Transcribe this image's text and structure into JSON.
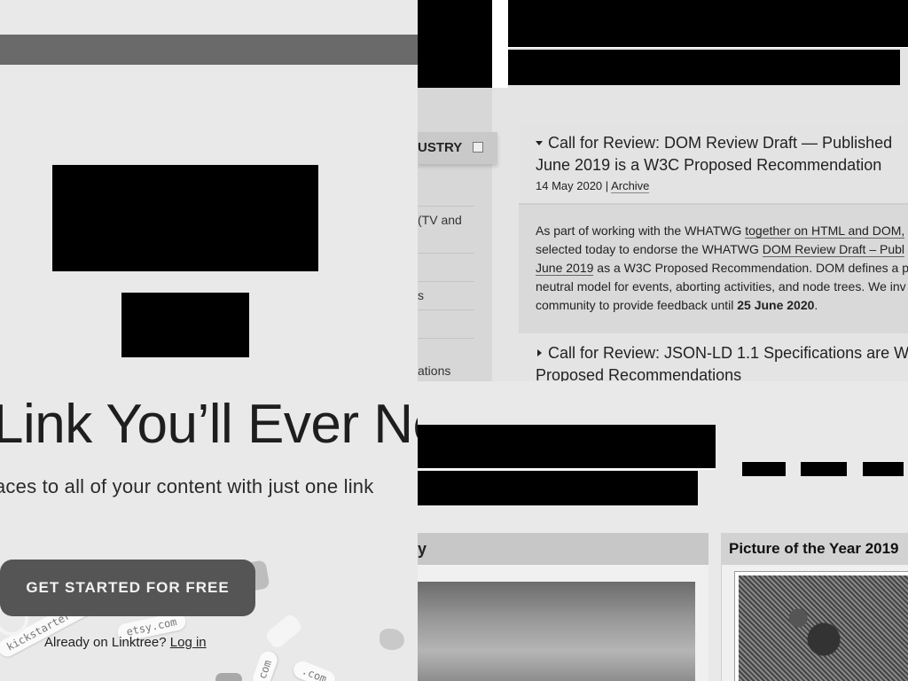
{
  "w3c": {
    "sidebar": {
      "industry_label": "USTRY",
      "items": [
        "(TV and",
        "s",
        "ations"
      ]
    },
    "news": [
      {
        "title_line1": "Call for Review: DOM Review Draft — Published",
        "title_line2": "June 2019 is a W3C Proposed Recommendation",
        "date": "14 May 2020",
        "separator": " | ",
        "archive_label": "Archive",
        "body": {
          "l1a": "As part of working with the WHATWG ",
          "l1b": "together on HTML and DOM,",
          "l2a": "selected today to endorse the WHATWG ",
          "l2b": "DOM Review Draft – Publ",
          "l3a": "June 2019",
          "l3b": " as a W3C Proposed Recommendation. DOM defines a p",
          "l4": "neutral model for events, aborting activities, and node trees. We inv",
          "l5a": "community to provide feedback until ",
          "l5b": "25 June 2020",
          "l5c": "."
        }
      },
      {
        "title_line1": "Call for Review: JSON-LD 1.1 Specifications are W",
        "title_line2": "Proposed Recommendations"
      }
    ]
  },
  "bottom": {
    "panel1_title": "y",
    "panel2_title": "Picture of the Year 2019"
  },
  "linktree": {
    "headline": "Link You’ll Ever Ne",
    "subheadline": "aces to all of your content with just one link",
    "cta_label": "GET STARTED FOR FREE",
    "already_text": "Already on Linktree? ",
    "login_label": "Log in",
    "tags": [
      "kickstarter.com",
      "etsy.com",
      "com",
      ".com"
    ]
  }
}
